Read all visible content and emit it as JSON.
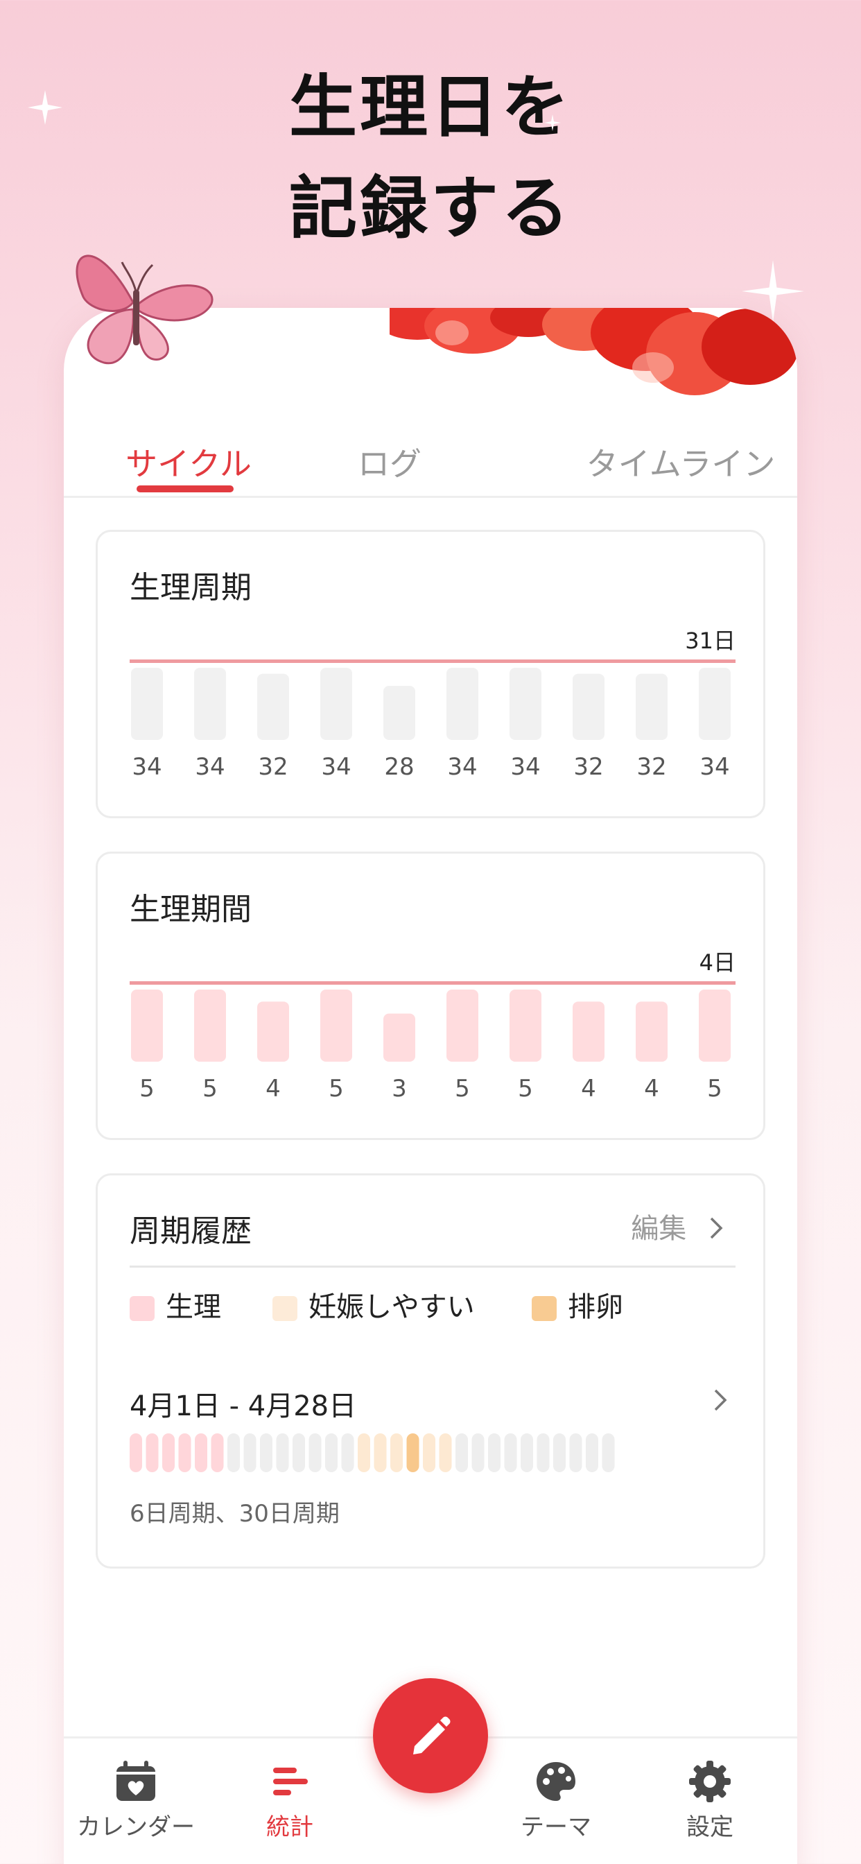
{
  "headline": {
    "line1": "生理日を",
    "line2": "記録する"
  },
  "tabs": [
    {
      "label": "サイクル",
      "active": true
    },
    {
      "label": "ログ",
      "active": false
    },
    {
      "label": "タイムライン",
      "active": false
    }
  ],
  "cycle_card": {
    "title": "生理周期",
    "average_label": "31日"
  },
  "period_card": {
    "title": "生理期間",
    "average_label": "4日"
  },
  "history_card": {
    "title": "周期履歴",
    "edit_label": "編集",
    "legend": [
      "生理",
      "妊娠しやすい",
      "排卵"
    ],
    "entry": {
      "range": "4月1日 -  4月28日",
      "summary": "6日周期、30日周期",
      "period_days": 6,
      "fertile_days": [
        15,
        16,
        17,
        19,
        20
      ],
      "ovulation_day": 18,
      "total_days": 30
    }
  },
  "chart_data": [
    {
      "type": "bar",
      "title": "生理周期",
      "categories": [
        "",
        "",
        "",
        "",
        "",
        "",
        "",
        "",
        "",
        ""
      ],
      "values": [
        34,
        34,
        32,
        34,
        28,
        34,
        34,
        32,
        32,
        34
      ],
      "average": 31,
      "average_label": "31日",
      "bar_color": "#f1f1f1",
      "line_color": "#ef9a9f"
    },
    {
      "type": "bar",
      "title": "生理期間",
      "categories": [
        "",
        "",
        "",
        "",
        "",
        "",
        "",
        "",
        "",
        ""
      ],
      "values": [
        5,
        5,
        4,
        5,
        3,
        5,
        5,
        4,
        4,
        5
      ],
      "average": 4,
      "average_label": "4日",
      "bar_color": "#ffdcde",
      "line_color": "#ef9a9f"
    }
  ],
  "colors": {
    "accent": "#e23a3f",
    "period": "#ffd6da",
    "fertile": "#fde9d2",
    "ovulation": "#f8c88c",
    "neutral_day": "#eeeeee"
  },
  "nav": [
    {
      "label": "カレンダー",
      "icon": "calendar-heart-icon",
      "active": false
    },
    {
      "label": "統計",
      "icon": "stats-bars-icon",
      "active": true
    },
    {
      "label": "テーマ",
      "icon": "palette-icon",
      "active": false
    },
    {
      "label": "設定",
      "icon": "gear-icon",
      "active": false
    }
  ],
  "fab": {
    "icon": "pencil-icon"
  }
}
